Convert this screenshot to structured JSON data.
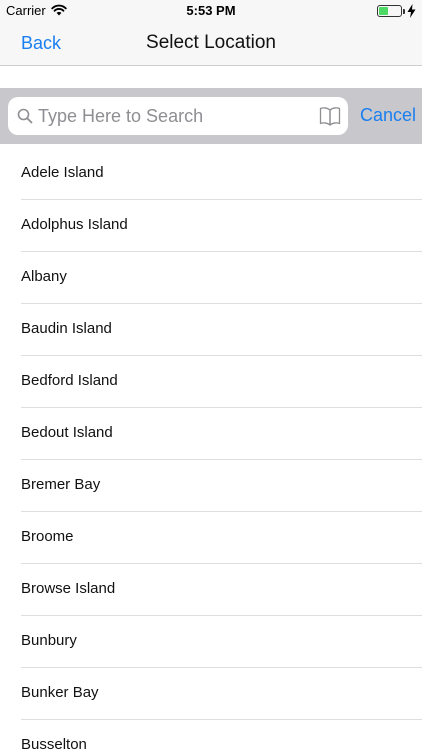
{
  "status_bar": {
    "carrier": "Carrier",
    "time": "5:53 PM",
    "battery_color": "#4cd964",
    "battery_level": 0.45,
    "icons": [
      "wifi-icon",
      "battery-icon",
      "charging-bolt-icon"
    ]
  },
  "nav": {
    "back_label": "Back",
    "title": "Select Location"
  },
  "search": {
    "placeholder": "Type Here to Search",
    "value": "",
    "cancel_label": "Cancel",
    "icons": [
      "search-icon",
      "bookmark-book-icon"
    ]
  },
  "accent_color": "#1a7ff0",
  "locations": [
    "Adele Island",
    "Adolphus Island",
    "Albany",
    "Baudin Island",
    "Bedford Island",
    "Bedout Island",
    "Bremer Bay",
    "Broome",
    "Browse Island",
    "Bunbury",
    "Bunker Bay",
    "Busselton"
  ]
}
